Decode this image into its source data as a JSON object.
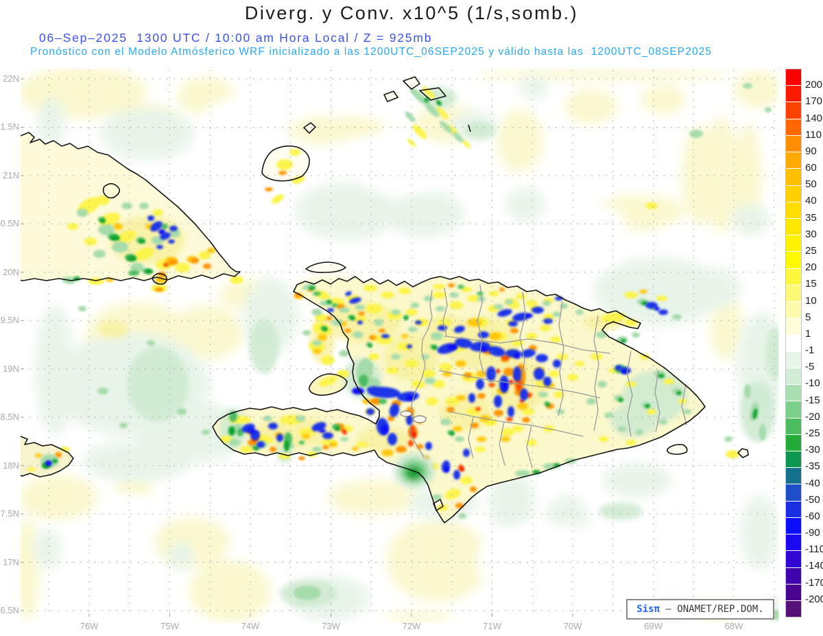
{
  "header": {
    "title": "Diverg. y Conv. x10^5 (1/s,somb.)",
    "subtitle1": "06–Sep–2025  1300 UTC / 10:00 am Hora Local / Z = 925mb",
    "subtitle2": "Pronóstico con el Modelo Atmósferico WRF inicializado a las 1200UTC_06SEP2025 y válido hasta las  1200UTC_08SEP2025",
    "title_color": "#1b1b1b",
    "subtitle1_color": "#3c52ea",
    "subtitle2_color": "#27a7f3"
  },
  "map": {
    "lat_ticks": [
      {
        "label": "22N",
        "lat": 22
      },
      {
        "label": "1.5N",
        "lat": 21.5
      },
      {
        "label": "21N",
        "lat": 21
      },
      {
        "label": "0.5N",
        "lat": 20.5
      },
      {
        "label": "20N",
        "lat": 20
      },
      {
        "label": "9.5N",
        "lat": 19.5
      },
      {
        "label": "19N",
        "lat": 19
      },
      {
        "label": "8.5N",
        "lat": 18.5
      },
      {
        "label": "18N",
        "lat": 18
      },
      {
        "label": "7.5N",
        "lat": 17.5
      },
      {
        "label": "17N",
        "lat": 17
      },
      {
        "label": "6.5N",
        "lat": 16.5
      }
    ],
    "lon_ticks": [
      {
        "label": "76W",
        "lon": 76
      },
      {
        "label": "75W",
        "lon": 75
      },
      {
        "label": "74W",
        "lon": 74
      },
      {
        "label": "73W",
        "lon": 73
      },
      {
        "label": "72W",
        "lon": 72
      },
      {
        "label": "71W",
        "lon": 71
      },
      {
        "label": "70W",
        "lon": 70
      },
      {
        "label": "69W",
        "lon": 69
      },
      {
        "label": "68W",
        "lon": 68
      }
    ],
    "grid_step_deg": 0.5
  },
  "colorbar": {
    "boundary_labels": [
      "200",
      "170",
      "140",
      "110",
      "90",
      "60",
      "50",
      "40",
      "35",
      "30",
      "25",
      "20",
      "15",
      "10",
      "5",
      "1",
      "-1",
      "-5",
      "-10",
      "-15",
      "-20",
      "-25",
      "-30",
      "-35",
      "-40",
      "-50",
      "-60",
      "-90",
      "-110",
      "-140",
      "-170",
      "-200"
    ],
    "segment_colors": [
      "#f60400",
      "#fb1c00",
      "#fc4200",
      "#fd6800",
      "#fe8d00",
      "#feaa00",
      "#febf00",
      "#ffd000",
      "#ffdd00",
      "#ffe800",
      "#fff200",
      "#fdf900",
      "#fcf83e",
      "#fcf977",
      "#fdfaab",
      "#fefcdb",
      "#ffffff",
      "#e7f4e8",
      "#d2ecd6",
      "#aadfb2",
      "#7ccf8a",
      "#4cbd5f",
      "#22ab38",
      "#0e9751",
      "#15728c",
      "#1e4fc9",
      "#1b2fe2",
      "#0b0efb",
      "#1c09ef",
      "#3206d4",
      "#4004ae",
      "#4a0390",
      "#551178"
    ]
  },
  "branding": {
    "logo_text": "Sisπ",
    "credit_text": " – ONAMET/REP.DOM.",
    "logo_color": "#2563eb"
  }
}
